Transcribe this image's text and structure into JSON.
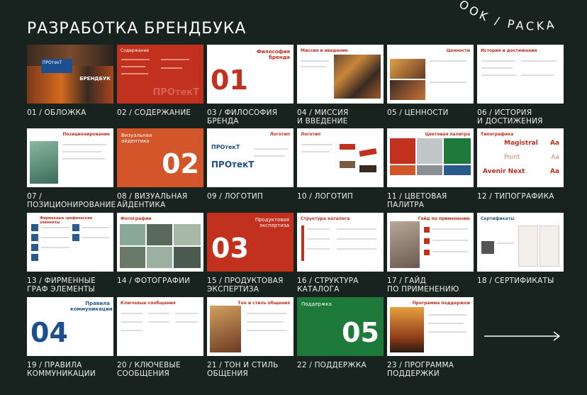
{
  "header": {
    "title": "РАЗРАБОТКА БРЕНДБУКА",
    "arc_text": "OOK / PACKA"
  },
  "cards": [
    {
      "caption1": "01 / ОБЛОЖКА",
      "caption2": "",
      "heading": "",
      "num": "",
      "logo": "ПРОтекТ",
      "sub": "БРЕНДБУК"
    },
    {
      "caption1": "02 / СОДЕРЖАНИЕ",
      "caption2": "",
      "heading": "Содержание",
      "num": "",
      "logo": "ПРОтекТ"
    },
    {
      "caption1": "03 / ФИЛОСОФИЯ",
      "caption2": "БРЕНДА",
      "heading": "Философия бренда",
      "num": "01"
    },
    {
      "caption1": "04 / МИССИЯ",
      "caption2": "И ВВЕДЕНИЕ",
      "heading": "Миссия и введение",
      "num": ""
    },
    {
      "caption1": "05 / ЦЕННОСТИ",
      "caption2": "",
      "heading": "Ценности",
      "num": ""
    },
    {
      "caption1": "06 / ИСТОРИЯ",
      "caption2": "И ДОСТИЖЕНИЯ",
      "heading": "История и достижения",
      "num": ""
    },
    {
      "caption1": "07 /",
      "caption2": "ПОЗИЦИОНИРОВАНИЕ",
      "heading": "Позиционирование",
      "num": ""
    },
    {
      "caption1": "08 / ВИЗУАЛЬНАЯ",
      "caption2": "АЙДЕНТИКА",
      "heading": "Визуальная айдентика",
      "num": "02"
    },
    {
      "caption1": "09 / ЛОГОТИП",
      "caption2": "",
      "heading": "Логотип",
      "num": "",
      "logo": "ПРОтекТ"
    },
    {
      "caption1": "10 / ЛОГОТИП",
      "caption2": "",
      "heading": "Логотип",
      "num": ""
    },
    {
      "caption1": "11 / ЦВЕТОВАЯ",
      "caption2": "ПАЛИТРА",
      "heading": "Цветовая палитра",
      "num": ""
    },
    {
      "caption1": "12 / ТИПОГРАФИКА",
      "caption2": "",
      "heading": "Типографика",
      "num": "",
      "fonts": [
        "Magistral",
        "Point",
        "Avenir Next"
      ],
      "glyph": "Aa"
    },
    {
      "caption1": "13 / ФИРМЕННЫЕ",
      "caption2": "ГРАФ ЭЛЕМЕНТЫ",
      "heading": "Фирменные графические элементы",
      "num": ""
    },
    {
      "caption1": "14 / ФОТОГРАФИИ",
      "caption2": "",
      "heading": "Фотографии",
      "num": ""
    },
    {
      "caption1": "15 / ПРОДУКТОВАЯ",
      "caption2": "ЭКСПЕРТИЗА",
      "heading": "Продуктовая экспертиза",
      "num": "03"
    },
    {
      "caption1": "16 / СТРУКТУРА",
      "caption2": "КАТАЛОГА",
      "heading": "Структура каталога",
      "num": ""
    },
    {
      "caption1": "17 / ГАЙД",
      "caption2": "ПО ПРИМЕНЕНИЮ",
      "heading": "Гайд по применению",
      "num": ""
    },
    {
      "caption1": "18 / СЕРТИФИКАТЫ",
      "caption2": "",
      "heading": "Сертификаты",
      "num": ""
    },
    {
      "caption1": "19 / ПРАВИЛА",
      "caption2": "КОММУНИКАЦИИ",
      "heading": "Правила коммуникации",
      "num": "04"
    },
    {
      "caption1": "20 / КЛЮЧЕВЫЕ",
      "caption2": "СООБЩЕНИЯ",
      "heading": "Ключевые сообщения",
      "num": ""
    },
    {
      "caption1": "21 / ТОН И СТИЛЬ",
      "caption2": "ОБЩЕНИЯ",
      "heading": "Тон и стиль общения",
      "num": ""
    },
    {
      "caption1": "22 / ПОДДЕРЖКА",
      "caption2": "",
      "heading": "Поддержка",
      "num": "05"
    },
    {
      "caption1": "23 / ПРОГРАММА",
      "caption2": "ПОДДЕРЖКИ",
      "heading": "Программа поддержки",
      "num": ""
    }
  ],
  "colors": {
    "bg": "#18231f",
    "red": "#c2311e",
    "orange": "#d3552a",
    "blue": "#1d4f8f",
    "green": "#1e7a3a"
  },
  "icons": {
    "next": "arrow-right-icon"
  }
}
